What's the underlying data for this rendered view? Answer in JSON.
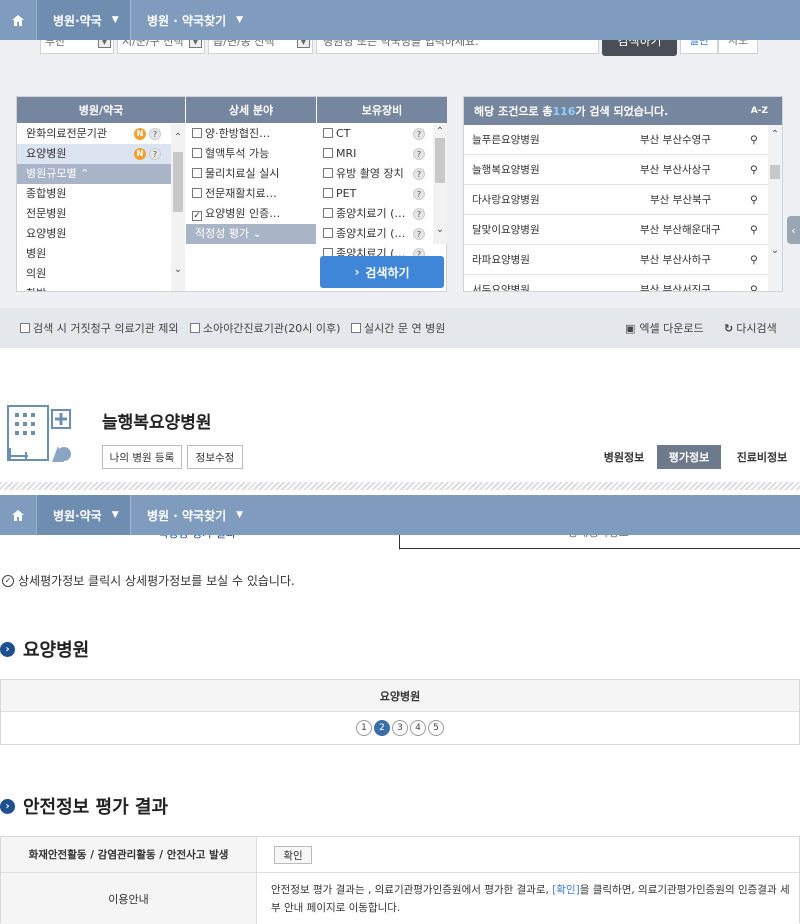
{
  "nav": {
    "home_icon": "home-icon",
    "tab1": "병원·약국",
    "tab2": "병원 · 약국찾기",
    "caret": "⌄"
  },
  "search": {
    "region1": "부산",
    "region2": "시/군/구 선택",
    "region3": "읍/면/동 선택",
    "placeholder": "병원명 또는 약국명을 입력하세요.",
    "button": "검색하기",
    "mode_general": "일반",
    "mode_map": "지도"
  },
  "filters": {
    "headers": [
      "병원/약국",
      "상세 분야",
      "보유장비"
    ],
    "types": [
      {
        "label": "완화의료전문기관",
        "badge": "N"
      },
      {
        "label": "요양병원",
        "badge": "N",
        "selected": true
      },
      {
        "label": "병원규모별 ⌃",
        "group": true
      },
      {
        "label": "종합병원"
      },
      {
        "label": "전문병원"
      },
      {
        "label": "요양병원"
      },
      {
        "label": "병원"
      },
      {
        "label": "의원"
      },
      {
        "label": "한방"
      }
    ],
    "details": [
      {
        "label": "양·한방협진…",
        "checked": false
      },
      {
        "label": "혈액투석 가능",
        "checked": false
      },
      {
        "label": "물리치료실 실시",
        "checked": false
      },
      {
        "label": "전문재활치료…",
        "checked": false
      },
      {
        "label": "요양병원 인증…",
        "checked": true
      }
    ],
    "detail_group": "적정성 평가 ⌄",
    "equipment": [
      {
        "label": "CT"
      },
      {
        "label": "MRI"
      },
      {
        "label": "유방 촬영 장치"
      },
      {
        "label": "PET"
      },
      {
        "label": "종양치료기 (…"
      },
      {
        "label": "종양치료기 (…"
      },
      {
        "label": "종양치료기 (…"
      }
    ],
    "search_button": "검색하기"
  },
  "results": {
    "header_prefix": "해당 조건으로 총 ",
    "count": "116",
    "header_suffix": "가 검색 되었습니다.",
    "sort_icon": "A-Z",
    "rows": [
      {
        "name": "늘푸른요양병원",
        "region": "부산 부산수영구"
      },
      {
        "name": "늘행복요양병원",
        "region": "부산 부산사상구"
      },
      {
        "name": "다사랑요양병원",
        "region": "부산 부산북구"
      },
      {
        "name": "달맞이요양병원",
        "region": "부산 부산해운대구"
      },
      {
        "name": "라파요양병원",
        "region": "부산 부산사하구"
      },
      {
        "name": "서두요양병원",
        "region": "부산 부산서진구"
      }
    ]
  },
  "options": {
    "opt1": "검색 시 거짓청구 의료기관 제외",
    "opt2": "소아야간진료기관(20시 이후)",
    "opt3": "실시간 문 연 병원",
    "excel": "엑셀 다운로드",
    "research": "다시검색"
  },
  "hospital": {
    "name": "늘행복요양병원",
    "btn_register": "나의 병원 등록",
    "btn_edit": "정보수정",
    "tab_info": "병원정보",
    "tab_eval": "평가정보",
    "tab_cost": "진료비정보"
  },
  "subtabs": {
    "left": "적정성 평가 결과",
    "right": "상세평가정보"
  },
  "notice": "상세평가정보 클릭시 상세평가정보를 보실 수 있습니다.",
  "section1": {
    "title": "요양병원",
    "table_head": "요양병원",
    "grades": [
      "1",
      "2",
      "3",
      "4",
      "5"
    ],
    "selected_grade": 2
  },
  "section2": {
    "title": "안전정보 평가 결과",
    "row1_label": "화재안전활동 / 감염관리활동 / 안전사고 발생",
    "row1_button": "확인",
    "row2_label": "이용안내",
    "row2_text1": "안전정보 평가 결과는 , 의료기관평가인증원에서 평가한 결과로, ",
    "row2_link": "[확인]",
    "row2_text2": "을 클릭하면, 의료기관평가인증원의 인증결과 세부 안내 페이지로 이동합니다."
  }
}
